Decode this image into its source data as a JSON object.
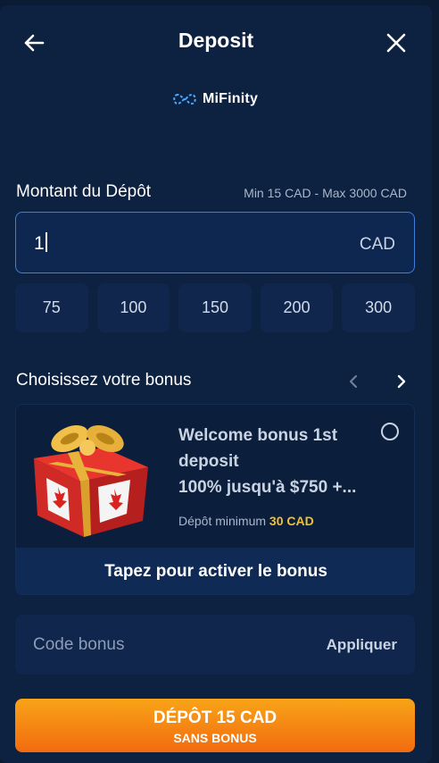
{
  "header": {
    "title": "Deposit"
  },
  "provider": {
    "name": "MiFinity"
  },
  "amount": {
    "label": "Montant du Dépôt",
    "limits": "Min 15 CAD - Max 3000 CAD",
    "value": "1",
    "currency": "CAD",
    "presets": [
      "75",
      "100",
      "150",
      "200",
      "300"
    ]
  },
  "bonus": {
    "section_title": "Choisissez votre bonus",
    "card": {
      "name": "Welcome bonus 1st deposit",
      "description": "100% jusqu'à $750 +...",
      "min_label": "Dépôt minimum",
      "min_value": "30 CAD",
      "activate_label": "Tapez pour activer le bonus"
    }
  },
  "promo": {
    "placeholder": "Code bonus",
    "apply_label": "Appliquer"
  },
  "cta": {
    "main": "DÉPÔT 15 CAD",
    "sub": "SANS BONUS"
  },
  "colors": {
    "background": "#0d2141",
    "accent_orange": "#f5861a",
    "input_border": "#3d7fd9",
    "highlight_yellow": "#f2c12e"
  }
}
